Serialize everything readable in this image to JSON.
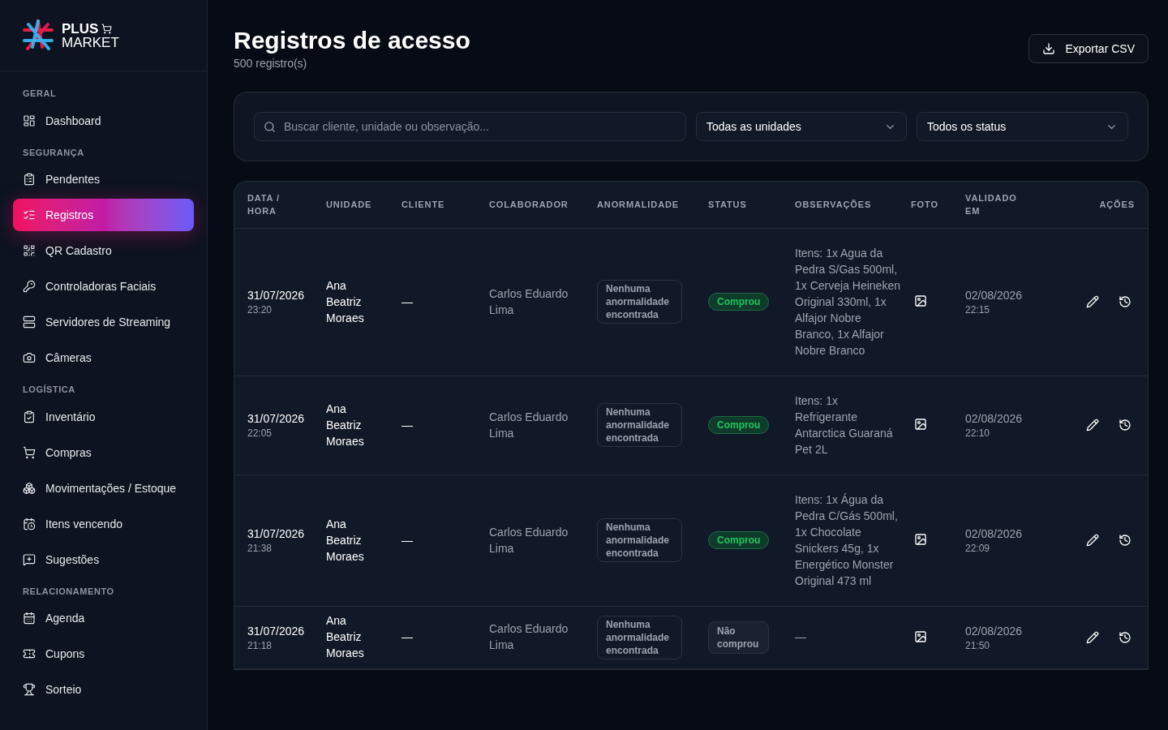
{
  "brand": {
    "line_1": "PLUS",
    "line_2": "MARKET"
  },
  "sidebar": {
    "sections": [
      {
        "title": "GERAL",
        "items": [
          {
            "label": "Dashboard",
            "selected": false
          }
        ]
      },
      {
        "title": "SEGURANÇA",
        "items": [
          {
            "label": "Pendentes",
            "selected": false
          },
          {
            "label": "Registros",
            "selected": true
          },
          {
            "label": "QR Cadastro",
            "selected": false
          },
          {
            "label": "Controladoras Faciais",
            "selected": false
          },
          {
            "label": "Servidores de Streaming",
            "selected": false
          },
          {
            "label": "Câmeras",
            "selected": false
          }
        ]
      },
      {
        "title": "LOGÍSTICA",
        "items": [
          {
            "label": "Inventário",
            "selected": false
          },
          {
            "label": "Compras",
            "selected": false
          },
          {
            "label": "Movimentações / Estoque",
            "selected": false
          },
          {
            "label": "Itens vencendo",
            "selected": false
          },
          {
            "label": "Sugestões",
            "selected": false
          }
        ]
      },
      {
        "title": "RELACIONAMENTO",
        "items": [
          {
            "label": "Agenda",
            "selected": false
          },
          {
            "label": "Cupons",
            "selected": false
          },
          {
            "label": "Sorteio",
            "selected": false
          }
        ]
      }
    ]
  },
  "header": {
    "title": "Registros de acesso",
    "count": "500 registro(s)",
    "export_button": "Exportar CSV"
  },
  "filters": {
    "search": {
      "placeholder": "Buscar cliente, unidade ou observação..."
    },
    "unit_select": "Todas as unidades",
    "status_select": "Todos os status"
  },
  "table": {
    "columns": [
      "DATA / HORA",
      "UNIDADE",
      "CLIENTE",
      "COLABORADOR",
      "ANORMALIDADE",
      "STATUS",
      "OBSERVAÇÕES",
      "FOTO",
      "VALIDADO EM",
      "AÇÕES"
    ],
    "rows": [
      {
        "date": "31/07/2026",
        "time": "23:20",
        "unit": "Ana Beatriz Moraes",
        "client": "—",
        "employee": "Carlos Eduardo Lima",
        "anomaly": "Nenhuma anormalidade encontrada",
        "status": {
          "label": "Comprou",
          "kind": "positive"
        },
        "notes": "Itens: 1x Agua da Pedra S/Gas 500ml, 1x Cerveja Heineken Original 330ml, 1x Alfajor Nobre Branco, 1x Alfajor Nobre Branco",
        "validated_date": "02/08/2026",
        "validated_time": "22:15"
      },
      {
        "date": "31/07/2026",
        "time": "22:05",
        "unit": "Ana Beatriz Moraes",
        "client": "—",
        "employee": "Carlos Eduardo Lima",
        "anomaly": "Nenhuma anormalidade encontrada",
        "status": {
          "label": "Comprou",
          "kind": "positive"
        },
        "notes": "Itens: 1x Refrigerante Antarctica Guaraná Pet 2L",
        "validated_date": "02/08/2026",
        "validated_time": "22:10"
      },
      {
        "date": "31/07/2026",
        "time": "21:38",
        "unit": "Ana Beatriz Moraes",
        "client": "—",
        "employee": "Carlos Eduardo Lima",
        "anomaly": "Nenhuma anormalidade encontrada",
        "status": {
          "label": "Comprou",
          "kind": "positive"
        },
        "notes": "Itens: 1x Água da Pedra C/Gás 500ml, 1x Chocolate Snickers 45g, 1x Energético Monster Original 473 ml",
        "validated_date": "02/08/2026",
        "validated_time": "22:09"
      },
      {
        "date": "31/07/2026",
        "time": "21:18",
        "unit": "Ana Beatriz Moraes",
        "client": "—",
        "employee": "Carlos Eduardo Lima",
        "anomaly": "Nenhuma anormalidade encontrada",
        "status": {
          "label": "Não comprou",
          "kind": "neutral"
        },
        "notes": "—",
        "validated_date": "02/08/2026",
        "validated_time": "21:50"
      }
    ]
  }
}
